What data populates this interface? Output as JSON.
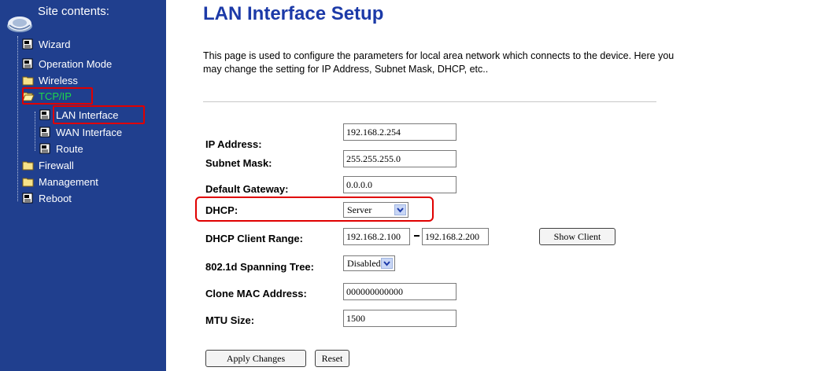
{
  "sidebar": {
    "title": "Site contents:",
    "items": [
      {
        "label": "Wizard",
        "icon": "document-icon"
      },
      {
        "label": "Operation Mode",
        "icon": "document-icon"
      },
      {
        "label": "Wireless",
        "icon": "folder-icon"
      },
      {
        "label": "TCP/IP",
        "icon": "folder-open-icon",
        "highlighted": true,
        "color": "#1ed84a"
      },
      {
        "label": "LAN Interface",
        "icon": "document-icon",
        "highlighted": true
      },
      {
        "label": "WAN Interface",
        "icon": "document-icon"
      },
      {
        "label": "Route",
        "icon": "document-icon"
      },
      {
        "label": "Firewall",
        "icon": "folder-icon"
      },
      {
        "label": "Management",
        "icon": "folder-icon"
      },
      {
        "label": "Reboot",
        "icon": "document-icon"
      }
    ]
  },
  "main": {
    "title": "LAN Interface Setup",
    "description": "This page is used to configure the parameters for local area network which connects to the device. Here you may change the setting for IP Address, Subnet Mask, DHCP, etc..",
    "fields": {
      "ip_address": {
        "label": "IP Address:",
        "value": "192.168.2.254"
      },
      "subnet_mask": {
        "label": "Subnet Mask:",
        "value": "255.255.255.0"
      },
      "default_gateway": {
        "label": "Default Gateway:",
        "value": "0.0.0.0"
      },
      "dhcp": {
        "label": "DHCP:",
        "value": "Server"
      },
      "dhcp_client_range": {
        "label": "DHCP Client Range:",
        "start": "192.168.2.100",
        "end": "192.168.2.200",
        "show_client_label": "Show Client"
      },
      "spanning_tree": {
        "label": "802.1d Spanning Tree:",
        "value": "Disabled"
      },
      "clone_mac": {
        "label": "Clone MAC Address:",
        "value": "000000000000"
      },
      "mtu": {
        "label": "MTU Size:",
        "value": "1500"
      }
    },
    "buttons": {
      "apply": "Apply Changes",
      "reset": "Reset"
    }
  },
  "colors": {
    "sidebar_bg": "#203f8e",
    "title_blue": "#1c3aa8",
    "highlight_red": "#e00000",
    "active_green": "#1ed84a"
  }
}
